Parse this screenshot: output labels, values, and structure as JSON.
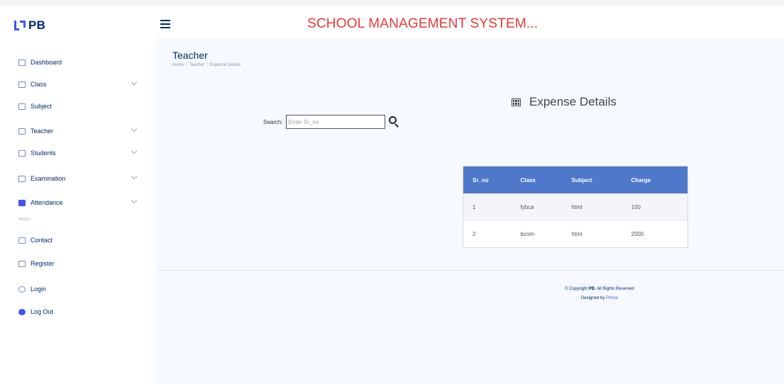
{
  "header": {
    "logo_text": "PB",
    "app_title": "SCHOOL MANAGEMENT SYSTEM..."
  },
  "sidebar": {
    "items": [
      {
        "label": "Dashboard",
        "icon": "grid-icon",
        "has_chevron": false
      },
      {
        "label": "Class",
        "icon": "building-icon",
        "has_chevron": true
      },
      {
        "label": "Subject",
        "icon": "layout-icon",
        "has_chevron": false
      },
      {
        "label": "Teacher",
        "icon": "person-icon",
        "has_chevron": true
      },
      {
        "label": "Students",
        "icon": "people-icon",
        "has_chevron": true
      },
      {
        "label": "Examination",
        "icon": "list-icon",
        "has_chevron": true
      },
      {
        "label": "Attendance",
        "icon": "chart-icon",
        "has_chevron": true
      },
      {
        "label": "Contact",
        "icon": "envelope-icon",
        "has_chevron": false
      },
      {
        "label": "Register",
        "icon": "card-icon",
        "has_chevron": false
      },
      {
        "label": "Login",
        "icon": "login-icon",
        "has_chevron": false
      },
      {
        "label": "Log Out",
        "icon": "gear-icon",
        "has_chevron": false
      }
    ],
    "heading": "Pages"
  },
  "main": {
    "page_title": "Teacher",
    "breadcrumb": [
      "Home",
      "Teacher",
      "Expense Details"
    ],
    "search": {
      "label": "Search:",
      "placeholder": "Enter Sr_no"
    },
    "section_title": "Expense Details",
    "table": {
      "columns": [
        "Sr_no",
        "Class",
        "Subject",
        "Charge"
      ],
      "rows": [
        [
          "1",
          "fybca",
          "html",
          "100"
        ],
        [
          "2",
          "bcom",
          "html",
          "2000"
        ]
      ]
    }
  },
  "footer": {
    "copyright_prefix": "© Copyright",
    "brand": "PB",
    "rights": ". All Rights Reserved",
    "designed_by": "Designed by",
    "designer": "Prince"
  },
  "colors": {
    "accent": "#4154f1",
    "title_red": "#e53935",
    "table_header": "#4e78c9",
    "navy": "#012970"
  }
}
